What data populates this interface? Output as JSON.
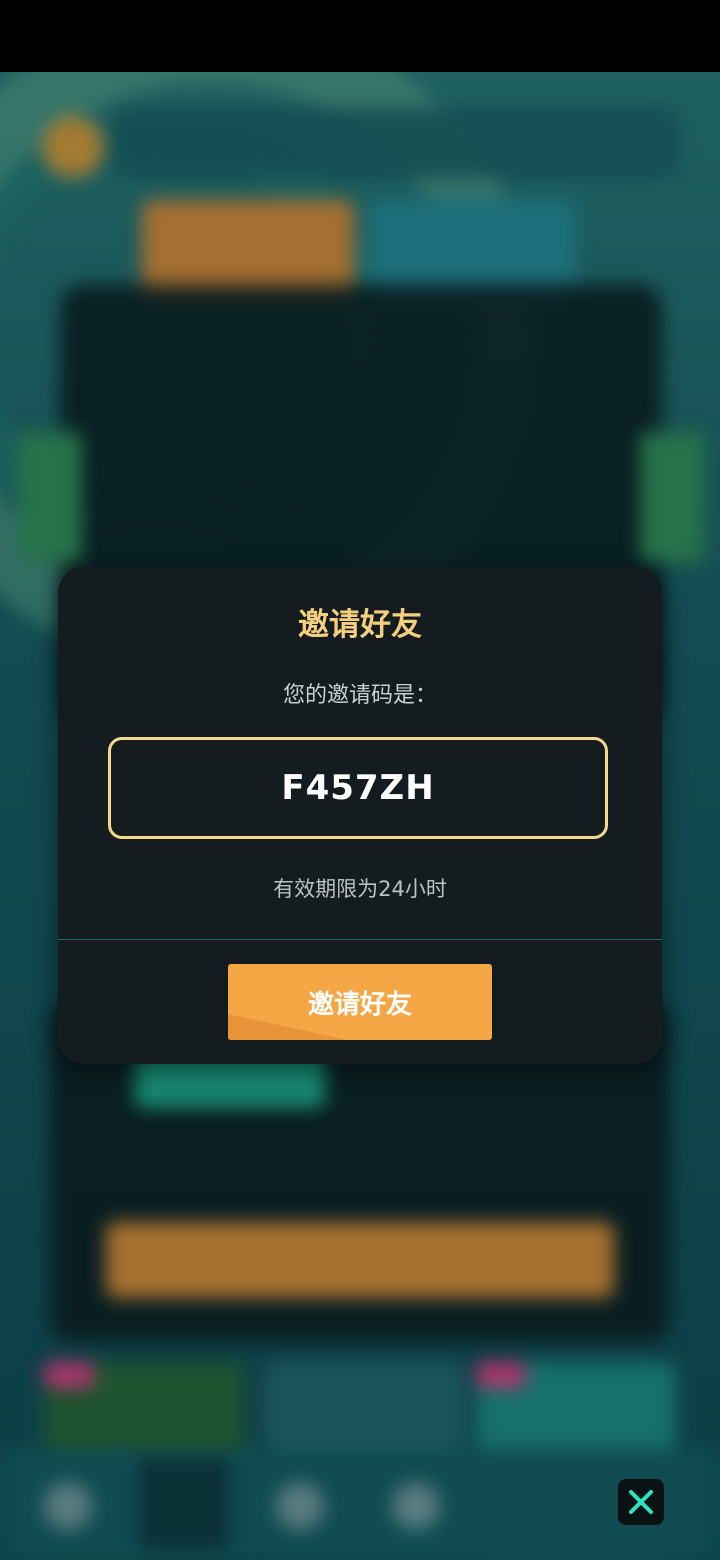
{
  "dialog": {
    "title": "邀请好友",
    "prompt": "您的邀请码是：",
    "invite_code": "F457ZH",
    "validity_note": "有效期限为24小时",
    "invite_button_label": "邀请好友"
  },
  "colors": {
    "title_gold": "#f6cf7e",
    "code_border": "#f3d98b",
    "button_orange": "#f6a745",
    "dialog_bg": "#151c20",
    "close_icon": "#2fe3c2"
  },
  "icons": {
    "close": "close-icon"
  }
}
